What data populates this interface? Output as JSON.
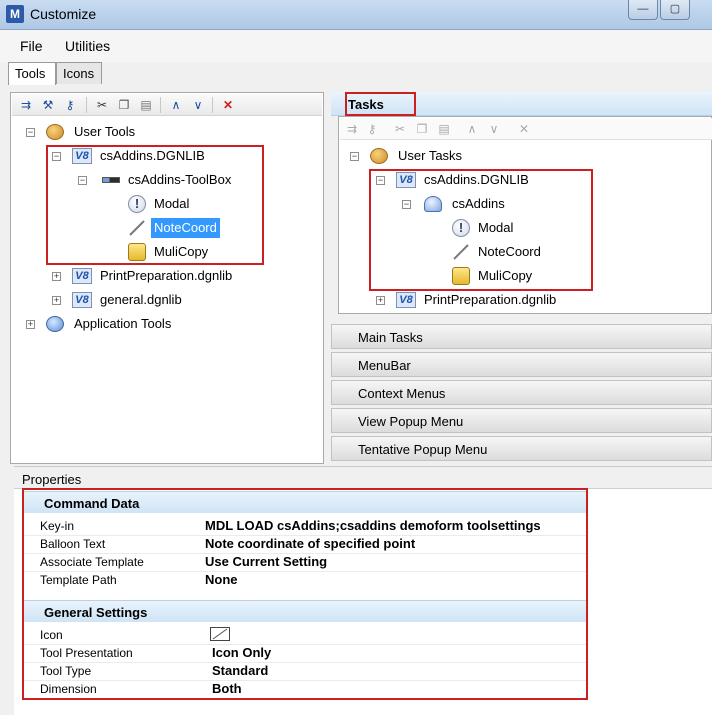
{
  "window": {
    "title": "Customize",
    "app_icon_letter": "M"
  },
  "window_buttons": {
    "minimize": "—",
    "maximize": "▢"
  },
  "menu": {
    "items": [
      "File",
      "Utilities"
    ]
  },
  "tabs": [
    {
      "label": "Tools",
      "active": true
    },
    {
      "label": "Icons",
      "active": false
    }
  ],
  "left_tree": {
    "root": "User Tools",
    "lib": "csAddins.DGNLIB",
    "toolbox": "csAddins-ToolBox",
    "tools": [
      "Modal",
      "NoteCoord",
      "MuliCopy"
    ],
    "other_libs": [
      "PrintPreparation.dgnlib",
      "general.dgnlib"
    ],
    "app_tools": "Application Tools"
  },
  "tasks": {
    "header": "Tasks",
    "root": "User Tasks",
    "lib": "csAddins.DGNLIB",
    "group": "csAddins",
    "items": [
      "Modal",
      "NoteCoord",
      "MuliCopy"
    ],
    "other_lib": "PrintPreparation.dgnlib"
  },
  "accordion": [
    "Main Tasks",
    "MenuBar",
    "Context Menus",
    "View Popup Menu",
    "Tentative Popup Menu"
  ],
  "properties": {
    "label": "Properties",
    "command_data": {
      "header": "Command Data",
      "rows": [
        {
          "key": "Key-in",
          "value": "MDL LOAD csAddins;csaddins demoform toolsettings"
        },
        {
          "key": "Balloon Text",
          "value": "Note coordinate of specified point"
        },
        {
          "key": "Associate Template",
          "value": "Use Current Setting"
        },
        {
          "key": "Template Path",
          "value": "None"
        }
      ]
    },
    "general_settings": {
      "header": "General Settings",
      "icon_label": "Icon",
      "rows": [
        {
          "key": "Tool Presentation",
          "value": "Icon Only"
        },
        {
          "key": "Tool Type",
          "value": "Standard"
        },
        {
          "key": "Dimension",
          "value": "Both"
        }
      ]
    }
  },
  "colors": {
    "selection": "#3399ff",
    "highlight_box": "#cc1f1f",
    "section_header": "#cfe4f6"
  },
  "icons": {
    "toolbar_left": [
      "new-toolbox-icon",
      "tool-icon",
      "key-icon",
      "cut-icon",
      "copy-icon",
      "paste-icon",
      "move-up-icon",
      "move-down-icon",
      "delete-icon"
    ],
    "toolbar_right": [
      "new-task-icon",
      "key-icon",
      "cut-icon",
      "copy-icon",
      "paste-icon",
      "move-up-icon",
      "move-down-icon",
      "delete-icon"
    ]
  }
}
